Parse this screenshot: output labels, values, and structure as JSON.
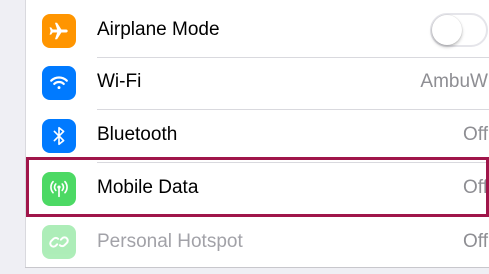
{
  "colors": {
    "airplane_icon_bg": "#ff9500",
    "wifi_icon_bg": "#007aff",
    "bluetooth_icon_bg": "#007aff",
    "mobile_data_icon_bg": "#4cd964",
    "hotspot_icon_bg": "#4cd964",
    "highlight_border": "#a0154a"
  },
  "settings": {
    "rows": [
      {
        "label": "Airplane Mode",
        "icon": "airplane-icon",
        "control": "toggle",
        "toggle_on": false
      },
      {
        "label": "Wi-Fi",
        "icon": "wifi-icon",
        "value": "AmbuW"
      },
      {
        "label": "Bluetooth",
        "icon": "bluetooth-icon",
        "value": "Off"
      },
      {
        "label": "Mobile Data",
        "icon": "antenna-icon",
        "value": "Off",
        "highlighted": true
      },
      {
        "label": "Personal Hotspot",
        "icon": "hotspot-link-icon",
        "value": "Off",
        "disabled": true
      }
    ]
  }
}
